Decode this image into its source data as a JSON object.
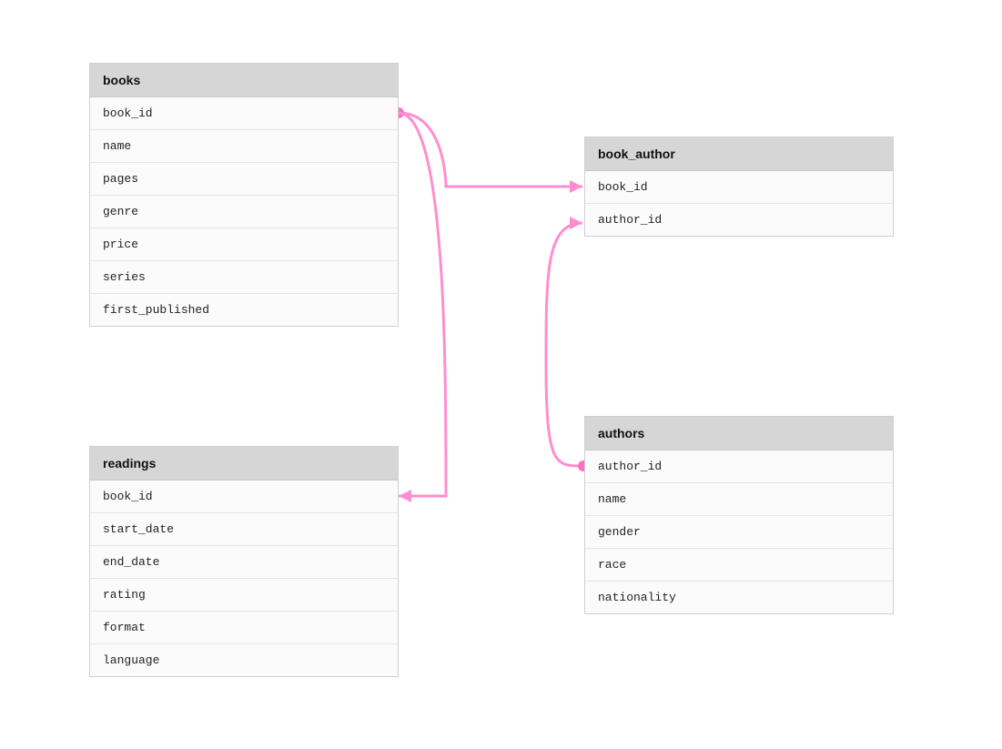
{
  "diagram": {
    "accent_color": "#ff6ec7",
    "tables": {
      "books": {
        "title": "books",
        "columns": [
          "book_id",
          "name",
          "pages",
          "genre",
          "price",
          "series",
          "first_published"
        ]
      },
      "book_author": {
        "title": "book_author",
        "columns": [
          "book_id",
          "author_id"
        ]
      },
      "readings": {
        "title": "readings",
        "columns": [
          "book_id",
          "start_date",
          "end_date",
          "rating",
          "format",
          "language"
        ]
      },
      "authors": {
        "title": "authors",
        "columns": [
          "author_id",
          "name",
          "gender",
          "race",
          "nationality"
        ]
      }
    },
    "relationships": [
      {
        "from": "books.book_id",
        "to": "book_author.book_id",
        "type": "one-to-many"
      },
      {
        "from": "books.book_id",
        "to": "readings.book_id",
        "type": "one-to-many"
      },
      {
        "from": "authors.author_id",
        "to": "book_author.author_id",
        "type": "one-to-many"
      }
    ]
  }
}
